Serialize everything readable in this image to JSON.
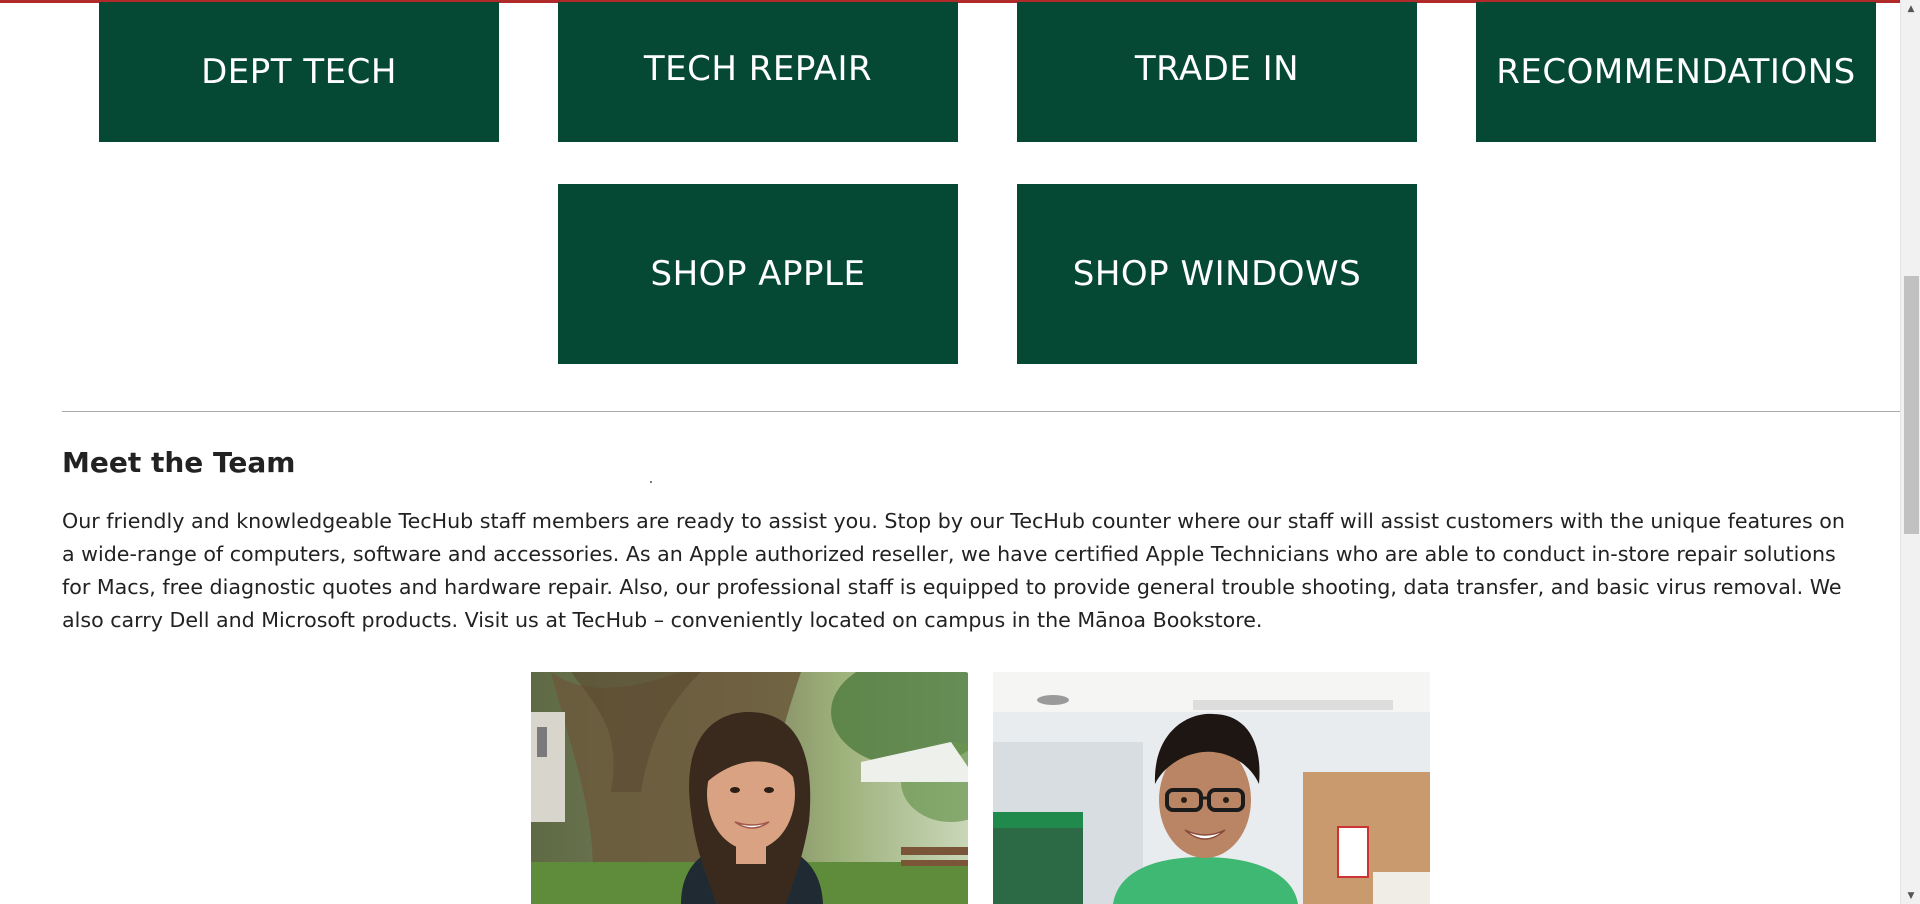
{
  "tiles": {
    "dept_tech": "DEPT TECH",
    "tech_repair": "TECH REPAIR",
    "trade_in": "TRADE IN",
    "recommendations": "RECOMMENDATIONS",
    "shop_apple": "SHOP APPLE",
    "shop_windows": "SHOP WINDOWS"
  },
  "team": {
    "heading": "Meet the Team",
    "paragraph": "Our friendly and knowledgeable TecHub staff members are ready to assist you. Stop by our TecHub counter where our staff will assist customers with the unique features on a wide-range of computers, software and accessories. As an Apple authorized reseller, we have certified Apple Technicians who are able to conduct in-store repair solutions for Macs, free diagnostic quotes and hardware repair. Also, our professional staff is equipped to provide general trouble shooting, data transfer, and basic virus removal. We also carry Dell and Microsoft products. Visit us at TecHub – conveniently located on campus in the Mānoa Bookstore."
  },
  "colors": {
    "tile_background": "#054833",
    "tile_text": "#ffffff",
    "top_accent": "#b02a2a"
  },
  "icons": {
    "scroll_up": "scroll-up-arrow-icon",
    "scroll_down": "scroll-down-arrow-icon"
  }
}
